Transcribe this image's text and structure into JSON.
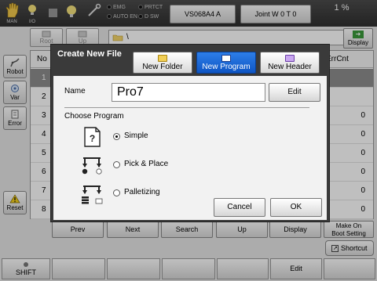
{
  "topbar": {
    "man_label": "MAN",
    "io_label": "I/O",
    "lights": [
      "EMG",
      "AUTO EN",
      "PRTCT",
      "D SW"
    ],
    "file_name": "VS068A4 A",
    "joint_label": "Joint  W 0 T 0",
    "speed_percent": "1 %"
  },
  "sidebar": {
    "robot_label": "Robot",
    "var_label": "Var",
    "error_label": "Error",
    "reset_label": "Reset"
  },
  "list": {
    "root_label": "Root",
    "up_label": "Up",
    "path_text": "\\",
    "display_label": "Display",
    "col_no": "No",
    "col_errcnt": "ErrCnt",
    "rows": [
      {
        "num": "1",
        "cnt": ""
      },
      {
        "num": "2",
        "cnt": ""
      },
      {
        "num": "3",
        "cnt": "0"
      },
      {
        "num": "4",
        "cnt": "0"
      },
      {
        "num": "5",
        "cnt": "0"
      },
      {
        "num": "6",
        "cnt": "0"
      },
      {
        "num": "7",
        "cnt": "0"
      },
      {
        "num": "8",
        "cnt": "0"
      }
    ]
  },
  "toolbar": {
    "prev": "Prev",
    "next": "Next",
    "search": "Search",
    "up": "Up",
    "display": "Display",
    "make_on_boot_1": "Make On",
    "make_on_boot_2": "Boot Setting"
  },
  "shortcut_label": "Shortcut",
  "fkeys": {
    "shift": "SHIFT",
    "edit": "Edit"
  },
  "dialog": {
    "title": "Create New File",
    "tab_new_folder": "New Folder",
    "tab_new_program": "New Program",
    "tab_new_header": "New Header",
    "name_label": "Name",
    "name_value": "Pro7",
    "edit_label": "Edit",
    "choose_label": "Choose Program",
    "options": [
      "Simple",
      "Pick & Place",
      "Palletizing"
    ],
    "selected_option": "Simple",
    "cancel_label": "Cancel",
    "ok_label": "OK"
  }
}
